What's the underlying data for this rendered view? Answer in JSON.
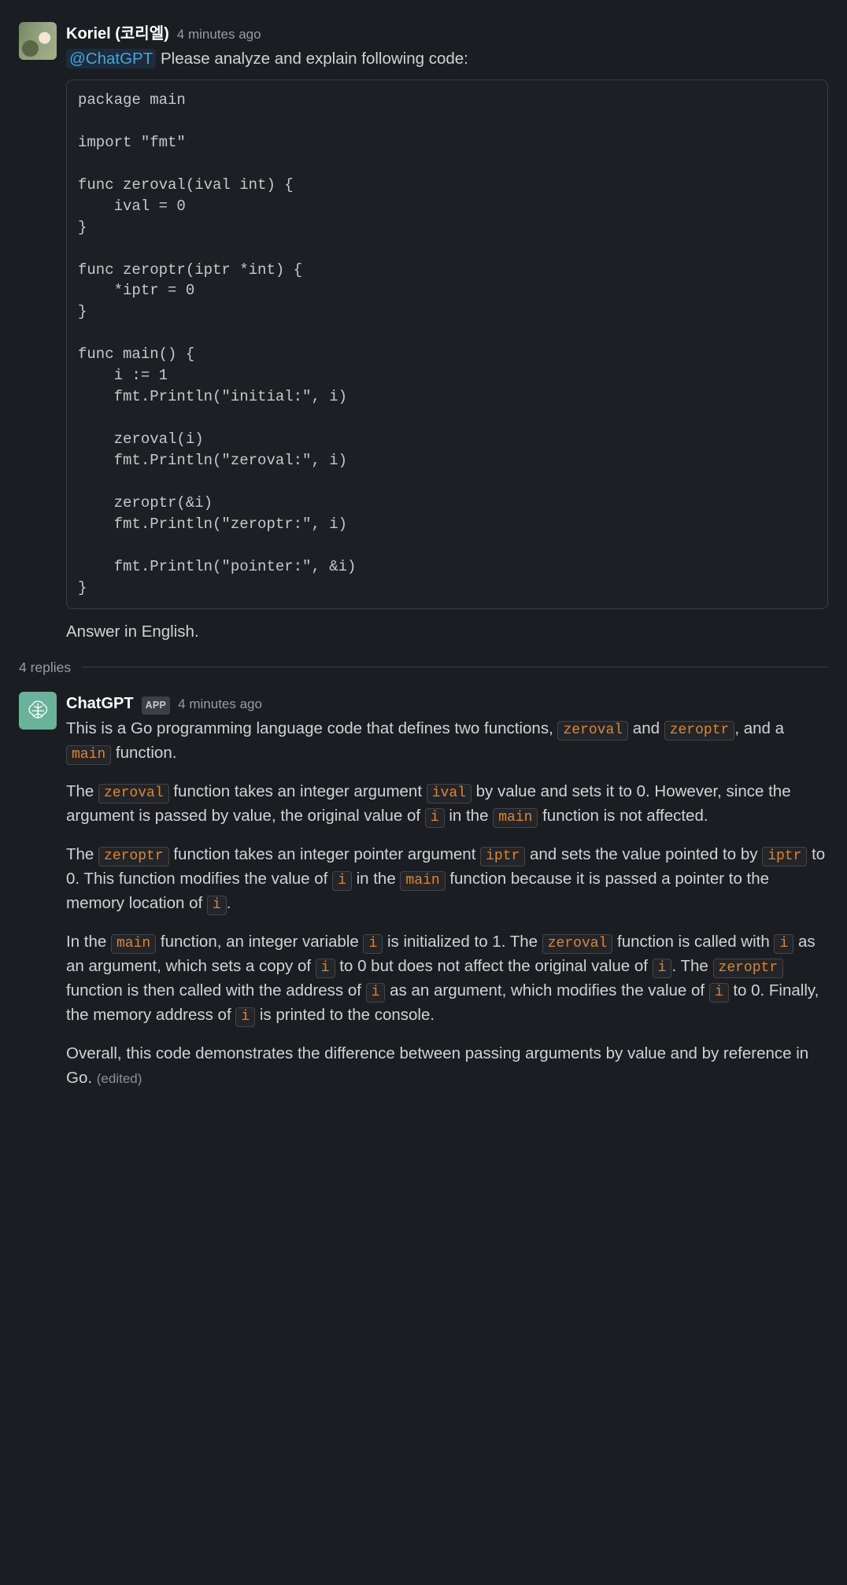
{
  "msg1": {
    "author": "Koriel (코리엘)",
    "timestamp": "4 minutes ago",
    "mention": "@ChatGPT",
    "intro_text": " Please analyze and explain following code:",
    "code": "package main\n\nimport \"fmt\"\n\nfunc zeroval(ival int) {\n    ival = 0\n}\n\nfunc zeroptr(iptr *int) {\n    *iptr = 0\n}\n\nfunc main() {\n    i := 1\n    fmt.Println(\"initial:\", i)\n\n    zeroval(i)\n    fmt.Println(\"zeroval:\", i)\n\n    zeroptr(&i)\n    fmt.Println(\"zeroptr:\", i)\n\n    fmt.Println(\"pointer:\", &i)\n}",
    "outro_text": "Answer in English."
  },
  "thread": {
    "replies_label": "4 replies"
  },
  "msg2": {
    "author": "ChatGPT",
    "badge": "APP",
    "timestamp": "4 minutes ago",
    "p1_a": "This is a Go programming language code that defines two functions, ",
    "p1_c1": "zeroval",
    "p1_b": " and ",
    "p1_c2": "zeroptr",
    "p1_c": ", and a ",
    "p1_c3": "main",
    "p1_d": " function.",
    "p2_a": "The ",
    "p2_c1": "zeroval",
    "p2_b": " function takes an integer argument ",
    "p2_c2": "ival",
    "p2_c": " by value and sets it to 0. However, since the argument is passed by value, the original value of ",
    "p2_c3": "i",
    "p2_d": " in the ",
    "p2_c4": "main",
    "p2_e": " function is not affected.",
    "p3_a": "The ",
    "p3_c1": "zeroptr",
    "p3_b": " function takes an integer pointer argument ",
    "p3_c2": "iptr",
    "p3_c": " and sets the value pointed to by ",
    "p3_c3": "iptr",
    "p3_d": " to 0. This function modifies the value of ",
    "p3_c4": "i",
    "p3_e": " in the ",
    "p3_c5": "main",
    "p3_f": " function because it is passed a pointer to the memory location of ",
    "p3_c6": "i",
    "p3_g": ".",
    "p4_a": "In the ",
    "p4_c1": "main",
    "p4_b": " function, an integer variable ",
    "p4_c2": "i",
    "p4_c": " is initialized to 1. The ",
    "p4_c3": "zeroval",
    "p4_d": " function is called with ",
    "p4_c4": "i",
    "p4_e": " as an argument, which sets a copy of ",
    "p4_c5": "i",
    "p4_f": " to 0 but does not affect the original value of ",
    "p4_c6": "i",
    "p4_g": ". The ",
    "p4_c7": "zeroptr",
    "p4_h": " function is then called with the address of ",
    "p4_c8": "i",
    "p4_i": " as an argument, which modifies the value of ",
    "p4_c9": "i",
    "p4_j": " to 0. Finally, the memory address of ",
    "p4_c10": "i",
    "p4_k": " is printed to the console.",
    "p5_a": "Overall, this code demonstrates the difference between passing arguments by value and by reference in Go. ",
    "edited": "(edited)"
  }
}
